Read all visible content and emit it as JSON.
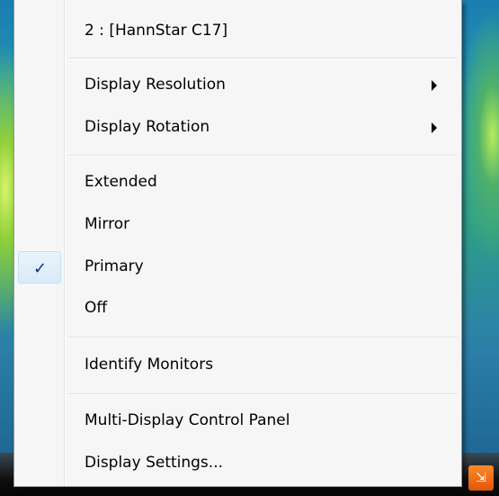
{
  "menu": {
    "header": "2 : [HannStar C17]",
    "resolution": "Display Resolution",
    "rotation": "Display Rotation",
    "extended": "Extended",
    "mirror": "Mirror",
    "primary": "Primary",
    "off": "Off",
    "identify": "Identify Monitors",
    "control_panel": "Multi-Display Control Panel",
    "settings": "Display Settings..."
  },
  "check_glyph": "✓",
  "checked_item": "Primary",
  "colors": {
    "menu_bg": "#f6f6f6",
    "check_color": "#0c2e8e",
    "check_box_bg": "#d9eaf8"
  },
  "icons": {
    "submenu": "right-triangle",
    "tray": "usb-orange"
  }
}
